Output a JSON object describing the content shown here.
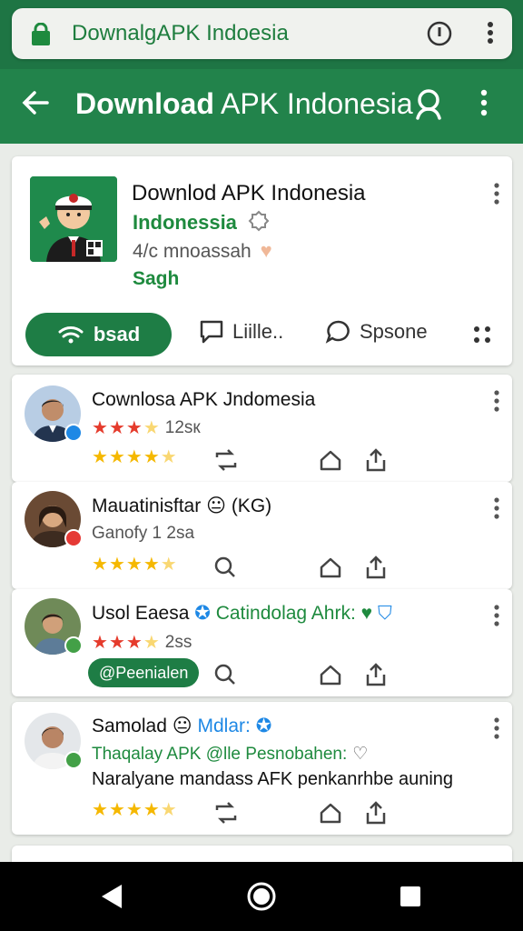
{
  "browser": {
    "url": "DownalgAPK Indoesia",
    "icons": [
      "lock-icon",
      "info-icon",
      "more-vert-icon"
    ]
  },
  "appbar": {
    "title_bold": "Download",
    "title_light": "APK Indonesia",
    "icons": [
      "back-arrow-icon",
      "search-icon",
      "more-vert-icon"
    ]
  },
  "hero": {
    "title": "Downlod APK Indonesia",
    "developer": "Indonessia",
    "meta": "4/c mnoassah",
    "tag": "Sagh",
    "primary_button": "bsad",
    "actions": [
      "Liille..",
      "Spsone"
    ]
  },
  "reviews": [
    {
      "name": "Cownlosa APK Jndomesia",
      "meta": "12sк",
      "badge_color": "#1e88e5"
    },
    {
      "name": "Mauatinisftar",
      "emoji": "😐",
      "suffix": "(KG)",
      "meta": "Ganofy 1 2sa",
      "badge_color": "#e53935"
    },
    {
      "name": "Usol Eaesa",
      "linked_app": "Catindolag Ahrk:",
      "meta": "2ss",
      "pill": "@Peenialen",
      "badge_color": "#43a047"
    },
    {
      "name": "Samolad",
      "emoji": "😐",
      "mention": "Mdlar:",
      "line1": "Thaqalay APK @lle Pesnobahen:",
      "line2": "Naralyane mandass AFK penkanrhbe auning",
      "badge_color": "#43a047"
    }
  ],
  "colors": {
    "primary": "#22834b",
    "accent_green": "#1e8a3e",
    "star_red": "#e53b2c",
    "star_yellow": "#f5b800"
  }
}
